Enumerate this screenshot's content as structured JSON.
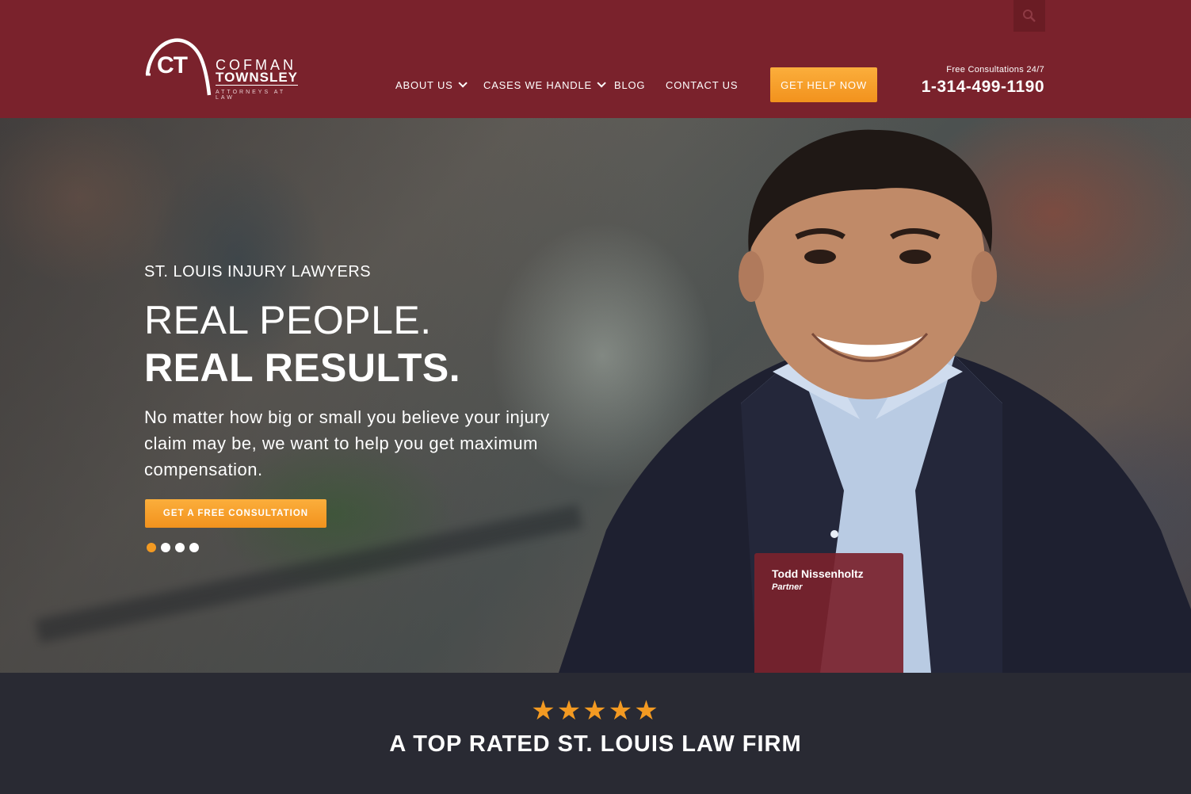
{
  "header": {
    "logo": {
      "monogram": "CT",
      "line1": "COFMAN",
      "line2": "TOWNSLEY",
      "line3": "ATTORNEYS AT LAW"
    },
    "search_icon": "search-icon",
    "nav": [
      {
        "label": "ABOUT US",
        "has_dropdown": true
      },
      {
        "label": "CASES WE HANDLE",
        "has_dropdown": true
      },
      {
        "label": "BLOG",
        "has_dropdown": false
      },
      {
        "label": "CONTACT US",
        "has_dropdown": false
      }
    ],
    "cta_label": "GET HELP NOW",
    "phone_label": "Free Consultations 24/7",
    "phone_number": "1-314-499-1190"
  },
  "hero": {
    "eyebrow": "ST. LOUIS INJURY LAWYERS",
    "headline_line1": "REAL PEOPLE.",
    "headline_line2": "REAL RESULTS.",
    "body": "No matter how big or small you believe your injury claim may be, we want to help you get maximum compensation.",
    "cta_label": "GET A FREE CONSULTATION",
    "slides": 4,
    "active_slide": 1,
    "person": {
      "name": "Todd Nissenholtz",
      "role": "Partner"
    }
  },
  "rating": {
    "stars": "★★★★★",
    "star_count": 5,
    "title": "A TOP RATED ST. LOUIS LAW FIRM"
  },
  "colors": {
    "brand_maroon": "#7a222c",
    "accent_orange": "#f39a22",
    "band_dark": "#292a33"
  }
}
